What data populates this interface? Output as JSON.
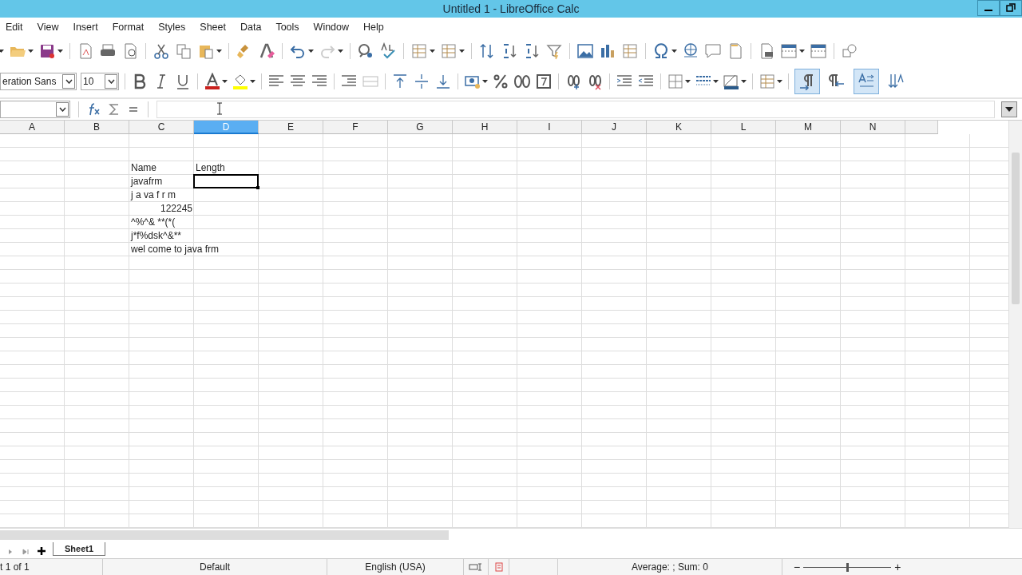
{
  "window": {
    "title": "Untitled 1 - LibreOffice Calc"
  },
  "menu": [
    "Edit",
    "View",
    "Insert",
    "Format",
    "Styles",
    "Sheet",
    "Data",
    "Tools",
    "Window",
    "Help"
  ],
  "font": {
    "name": "eration Sans",
    "size": "10"
  },
  "format_toggles": [
    {
      "kind": "ltr",
      "on": true
    },
    {
      "kind": "rtl",
      "on": false
    },
    {
      "kind": "wrap",
      "on": true
    },
    {
      "kind": "stacked",
      "on": false
    }
  ],
  "columns": [
    {
      "label": "A",
      "selected": false
    },
    {
      "label": "B",
      "selected": false
    },
    {
      "label": "C",
      "selected": false
    },
    {
      "label": "D",
      "selected": true
    },
    {
      "label": "E",
      "selected": false
    },
    {
      "label": "F",
      "selected": false
    },
    {
      "label": "G",
      "selected": false
    },
    {
      "label": "H",
      "selected": false
    },
    {
      "label": "I",
      "selected": false
    },
    {
      "label": "J",
      "selected": false
    },
    {
      "label": "K",
      "selected": false
    },
    {
      "label": "L",
      "selected": false
    },
    {
      "label": "M",
      "selected": false
    },
    {
      "label": "N",
      "selected": false
    }
  ],
  "cells": {
    "C3": {
      "kind": "text",
      "text": "Name"
    },
    "D3": {
      "kind": "text",
      "text": "Length"
    },
    "D4": {
      "kind": "cursor",
      "selected": true
    },
    "C4": {
      "kind": "text",
      "text": "javafrm"
    },
    "C5": {
      "kind": "text",
      "text": "j a va f r m"
    },
    "C6": {
      "kind": "number",
      "text": "122245"
    },
    "C7": {
      "kind": "text",
      "text": "^%^& **(*("
    },
    "C8": {
      "kind": "text",
      "text": "j*f%dsk^&**"
    },
    "C9": {
      "kind": "text",
      "text": "wel come to java frm"
    }
  },
  "sheet_tabs": [
    {
      "label": "Sheet1",
      "selected": true
    }
  ],
  "status_bar": {
    "sheet": "t 1 of 1",
    "style": "Default",
    "language": "English (USA)",
    "sum": "Average: ; Sum: 0"
  },
  "zoom": {
    "minus": "−",
    "plus": "+",
    "level": 0.5
  }
}
